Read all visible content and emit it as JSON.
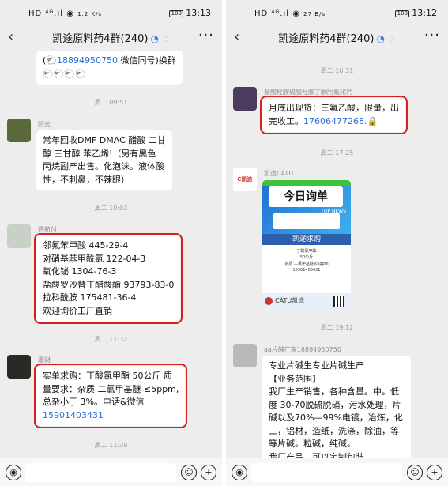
{
  "status": {
    "left_signal": "HD ⁴ᴳ.ıl ◉",
    "left_speed": "1.2 K/s",
    "left_battery": "100",
    "left_time": "13:13",
    "right_signal": "HD ⁴ᴳ.ıl ◉",
    "right_speed": "27 B/s",
    "right_battery": "100",
    "right_time": "13:12"
  },
  "chat": {
    "title": "凯途原料药4群(240)"
  },
  "left": {
    "msg0": {
      "line1": "(",
      "phone": "18894950750",
      "line1_rest": " 微信同号)换群",
      "emojis": "🐑🐑🐑🐑"
    },
    "time1": "周二 09:51",
    "msg1": {
      "sender": "阳光",
      "lines": [
        "常年回收DMF DMAC 醋酸 二甘",
        "醇 三甘醇 苯乙烯!（另有黑色",
        "丙烷副产出售。化泡沫。液体酸",
        "性，不刺鼻，不辣眼）"
      ]
    },
    "time2": "周二 10:03",
    "msg2": {
      "sender": "煜航付",
      "lines": [
        "邻氟苯甲酸 445-29-4",
        "对硝基苯甲酰氯 122-04-3",
        "氧化铋 1304-76-3",
        "盐酸罗沙替丁醋酸酯 93793-83-0",
        "拉科酰胺 175481-36-4",
        "欢迎询价工厂直销"
      ]
    },
    "time3": "周二 11:32",
    "msg3": {
      "sender": "瀑财",
      "lines": [
        "实单求购：丁酸氯甲酯 50公斤 质",
        "量要求：杂质 二氯甲基醚 ≤5ppm,",
        "总杂小于 3%。电话&微信"
      ],
      "phone": "15901403431"
    },
    "time4": "周二 11:39"
  },
  "right": {
    "time1": "周二 16:31",
    "msg1": {
      "sender": "盐酸羟胺硫酸羟胺丁酮肟氟化钙",
      "lines": [
        "月底出现货：三氟乙酸，限量，出",
        "完收工。"
      ],
      "phone": "17606477268."
    },
    "time2": "周二 17:25",
    "msg2": {
      "sender": "凯途CATU",
      "avatar_text": "C凯途",
      "banner": "今日询单",
      "news": "TOP NEWS",
      "header": "凯途求购",
      "body_lines": [
        "丁酸氯甲酯",
        "50公斤",
        "杂质 二氯甲基醚≤5ppm",
        "15901403431"
      ],
      "footer": "CATU凯途"
    },
    "time3": "周二 19:12",
    "msg3": {
      "sender": "aa片碱厂家18894950750",
      "lines": [
        "专业片碱生专业片碱生产",
        "【业务范围】",
        "我厂生产销售，各种含量。中。低",
        "度 30-70脱硫脱硝，污水处理，片",
        "碱以及70%—99%电镀，冶炼，化",
        "工，铝材，造纸，洗涤，除油，等",
        "等片碱。粒碱，纯碱。",
        "我厂产品，可以定制包装"
      ]
    }
  },
  "input": {
    "voice_icon": "◉",
    "emoji_icon": "☺",
    "plus_icon": "+"
  },
  "colors": {
    "highlight": "#d61f1f",
    "link": "#2a6fd6",
    "background": "#ededed"
  }
}
